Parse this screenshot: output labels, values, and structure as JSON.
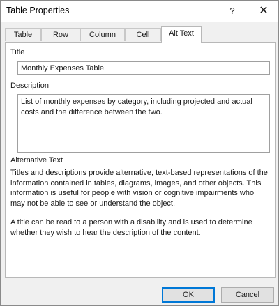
{
  "window": {
    "title": "Table Properties",
    "help_glyph": "?",
    "close_glyph": "✕"
  },
  "tabs": [
    {
      "label": "Table",
      "active": false
    },
    {
      "label": "Row",
      "active": false
    },
    {
      "label": "Column",
      "active": false
    },
    {
      "label": "Cell",
      "active": false
    },
    {
      "label": "Alt Text",
      "active": true
    }
  ],
  "alt_text": {
    "title_label": "Title",
    "title_value": "Monthly Expenses Table",
    "description_label": "Description",
    "description_value": "List of monthly expenses by category, including projected and actual costs and the difference between the two.",
    "section_heading": "Alternative Text",
    "paragraph_1": "Titles and descriptions provide alternative, text-based representations of the information contained in tables, diagrams, images, and other objects. This information is useful for people with vision or cognitive impairments who may not be able to see or understand the object.",
    "paragraph_2": "A title can be read to a person with a disability and is used to determine whether they wish to hear the description of the content."
  },
  "buttons": {
    "ok_label": "OK",
    "cancel_label": "Cancel"
  },
  "colors": {
    "focus_accent": "#0078d7",
    "dialog_background": "#f0f0f0",
    "panel_background": "#ffffff"
  }
}
